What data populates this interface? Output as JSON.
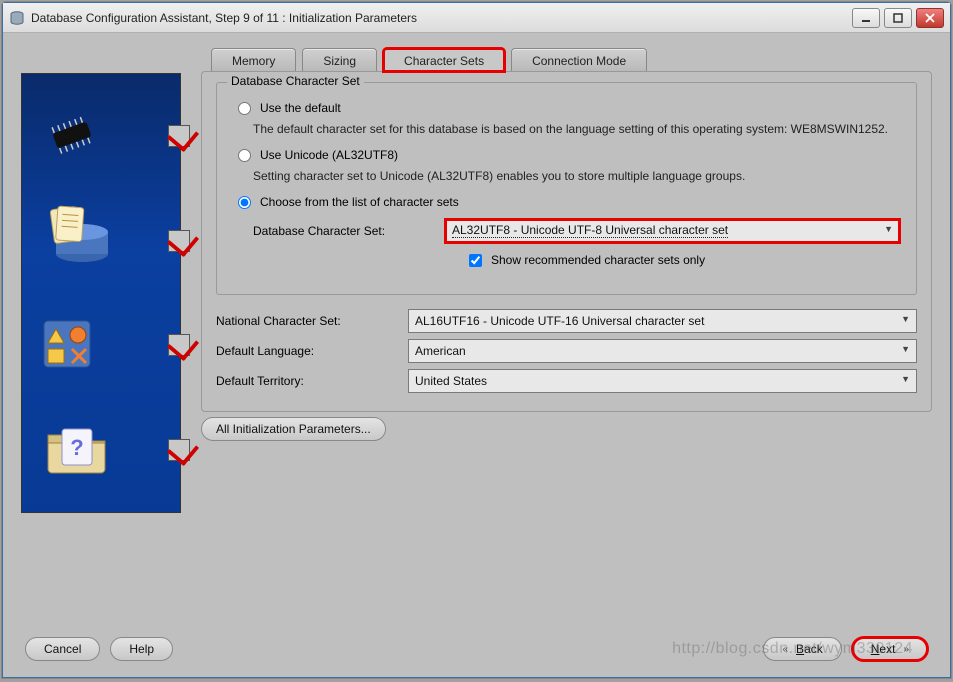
{
  "window": {
    "title": "Database Configuration Assistant, Step 9 of 11 : Initialization Parameters"
  },
  "tabs": {
    "memory": "Memory",
    "sizing": "Sizing",
    "charsets": "Character Sets",
    "connmode": "Connection Mode"
  },
  "groupCharset": {
    "legend": "Database Character Set",
    "optDefault": "Use the default",
    "optDefaultDesc": "The default character set for this database is based on the language setting of this operating system: WE8MSWIN1252.",
    "optUnicode": "Use Unicode (AL32UTF8)",
    "optUnicodeDesc": "Setting character set to Unicode (AL32UTF8) enables you to store multiple language groups.",
    "optChoose": "Choose from the list of character sets",
    "dbCharsetLabel": "Database Character Set:",
    "dbCharsetValue": "AL32UTF8 - Unicode UTF-8 Universal character set",
    "showRecommended": "Show recommended character sets only"
  },
  "other": {
    "nationalLabel": "National Character Set:",
    "nationalValue": "AL16UTF16 - Unicode UTF-16 Universal character set",
    "langLabel": "Default Language:",
    "langValue": "American",
    "territoryLabel": "Default Territory:",
    "territoryValue": "United States"
  },
  "buttons": {
    "allParams": "All Initialization Parameters...",
    "cancel": "Cancel",
    "help": "Help",
    "back": "Back",
    "next": "Next"
  },
  "watermark": "http://blog.csdn.net/wym330124"
}
